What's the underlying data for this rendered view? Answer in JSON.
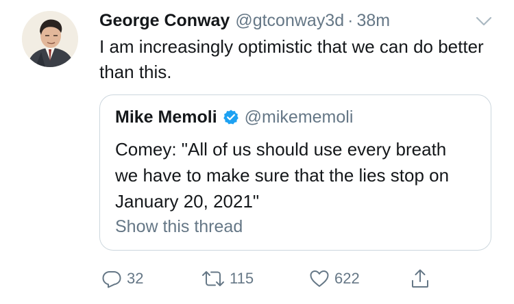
{
  "author": {
    "name": "George Conway",
    "handle": "@gtconway3d",
    "separator": "·",
    "timestamp": "38m"
  },
  "tweet": {
    "text": "I am increasingly optimistic that we can do better than this."
  },
  "quoted_tweet": {
    "name": "Mike Memoli",
    "verified": true,
    "handle": "@mikememoli",
    "text": "Comey: \"All of us should use every breath we have to make sure that the lies stop on January 20, 2021\"",
    "show_thread": "Show this thread"
  },
  "actions": {
    "reply_count": "32",
    "retweet_count": "115",
    "like_count": "622"
  },
  "icons": {
    "menu": "chevron-down-icon",
    "verified": "verified-badge-icon",
    "reply": "reply-icon",
    "retweet": "retweet-icon",
    "like": "heart-icon",
    "share": "share-icon"
  },
  "colors": {
    "text": "#14171a",
    "secondary": "#657786",
    "verified": "#1da1f2",
    "border": "#ccd6dd",
    "icon": "#657786"
  }
}
